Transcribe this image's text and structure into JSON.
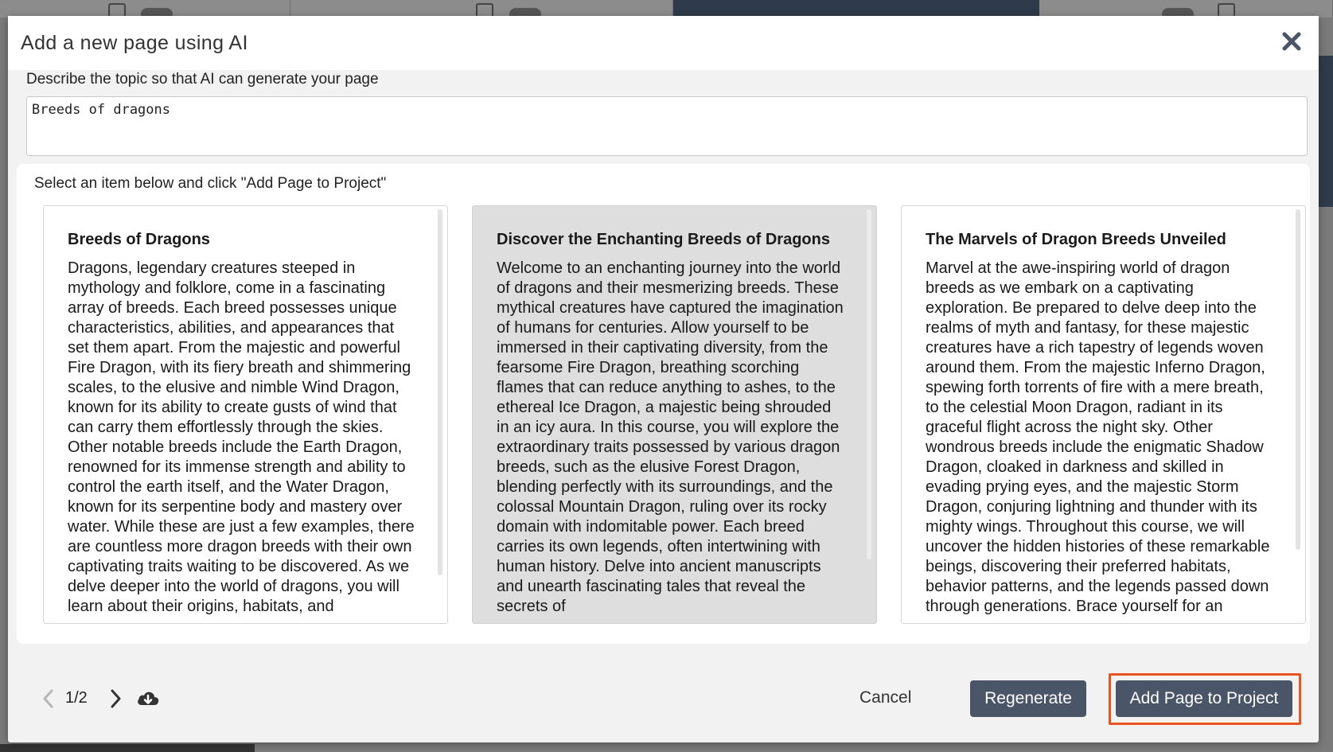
{
  "modal": {
    "title": "Add a new page using AI"
  },
  "prompt": {
    "label": "Describe the topic so that AI can generate your page",
    "value": "Breeds of dragons"
  },
  "results": {
    "instruction": "Select an item below and click \"Add Page to Project\"",
    "selected_index": 1,
    "cards": [
      {
        "title": "Breeds of Dragons",
        "body": "Dragons, legendary creatures steeped in mythology and folklore, come in a fascinating array of breeds. Each breed possesses unique characteristics, abilities, and appearances that set them apart. From the majestic and powerful Fire Dragon, with its fiery breath and shimmering scales, to the elusive and nimble Wind Dragon, known for its ability to create gusts of wind that can carry them effortlessly through the skies. Other notable breeds include the Earth Dragon, renowned for its immense strength and ability to control the earth itself, and the Water Dragon, known for its serpentine body and mastery over water. While these are just a few examples, there are countless more dragon breeds with their own captivating traits waiting to be discovered. As we delve deeper into the world of dragons, you will learn about their origins, habitats, and"
      },
      {
        "title": "Discover the Enchanting Breeds of Dragons",
        "body": "Welcome to an enchanting journey into the world of dragons and their mesmerizing breeds. These mythical creatures have captured the imagination of humans for centuries. Allow yourself to be immersed in their captivating diversity, from the fearsome Fire Dragon, breathing scorching flames that can reduce anything to ashes, to the ethereal Ice Dragon, a majestic being shrouded in an icy aura. In this course, you will explore the extraordinary traits possessed by various dragon breeds, such as the elusive Forest Dragon, blending perfectly with its surroundings, and the colossal Mountain Dragon, ruling over its rocky domain with indomitable power. Each breed carries its own legends, often intertwining with human history. Delve into ancient manuscripts and unearth fascinating tales that reveal the secrets of"
      },
      {
        "title": "The Marvels of Dragon Breeds Unveiled",
        "body": "Marvel at the awe-inspiring world of dragon breeds as we embark on a captivating exploration. Be prepared to delve deep into the realms of myth and fantasy, for these majestic creatures have a rich tapestry of legends woven around them. From the majestic Inferno Dragon, spewing forth torrents of fire with a mere breath, to the celestial Moon Dragon, radiant in its graceful flight across the night sky. Other wondrous breeds include the enigmatic Shadow Dragon, cloaked in darkness and skilled in evading prying eyes, and the majestic Storm Dragon, conjuring lightning and thunder with its mighty wings. Throughout this course, we will uncover the hidden histories of these remarkable beings, discovering their preferred habitats, behavior patterns, and the legends passed down through generations. Brace yourself for an"
      }
    ]
  },
  "footer": {
    "pager": "1/2",
    "cancel_label": "Cancel",
    "regenerate_label": "Regenerate",
    "add_label": "Add Page to Project"
  },
  "colors": {
    "primary_button": "#4a5668",
    "highlight_outline": "#e8531f",
    "selected_card": "#dedede"
  },
  "icons": {
    "close": "close-icon",
    "prev": "chevron-left-icon",
    "next": "chevron-right-icon",
    "download": "cloud-download-icon"
  }
}
